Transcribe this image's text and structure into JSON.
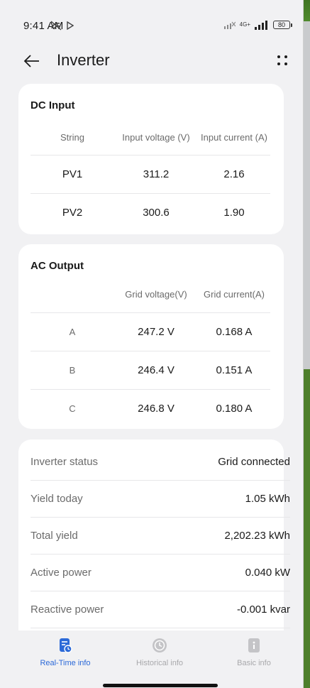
{
  "status_bar": {
    "time": "9:41 AM",
    "network_label": "4G+",
    "battery": "80"
  },
  "header": {
    "title": "Inverter"
  },
  "dc_input": {
    "title": "DC Input",
    "columns": [
      "String",
      "Input voltage (V)",
      "Input current (A)"
    ],
    "rows": [
      {
        "string": "PV1",
        "voltage": "311.2",
        "current": "2.16"
      },
      {
        "string": "PV2",
        "voltage": "300.6",
        "current": "1.90"
      }
    ]
  },
  "ac_output": {
    "title": "AC Output",
    "columns": [
      "",
      "Grid voltage(V)",
      "Grid current(A)"
    ],
    "rows": [
      {
        "phase": "A",
        "voltage": "247.2 V",
        "current": "0.168 A"
      },
      {
        "phase": "B",
        "voltage": "246.4 V",
        "current": "0.151 A"
      },
      {
        "phase": "C",
        "voltage": "246.8 V",
        "current": "0.180 A"
      }
    ]
  },
  "info": {
    "rows": [
      {
        "label": "Inverter status",
        "value": "Grid connected"
      },
      {
        "label": "Yield today",
        "value": "1.05 kWh"
      },
      {
        "label": "Total yield",
        "value": "2,202.23 kWh"
      },
      {
        "label": "Active power",
        "value": "0.040 kW"
      },
      {
        "label": "Reactive power",
        "value": "-0.001 kvar"
      }
    ]
  },
  "bottom_nav": {
    "items": [
      {
        "label": "Real-Time info",
        "icon": "realtime-info-icon",
        "active": true
      },
      {
        "label": "Historical info",
        "icon": "history-clock-icon",
        "active": false
      },
      {
        "label": "Basic info",
        "icon": "info-document-icon",
        "active": false
      }
    ]
  },
  "colors": {
    "accent": "#2b69d8",
    "background": "#f1f1f3",
    "card": "#ffffff"
  }
}
